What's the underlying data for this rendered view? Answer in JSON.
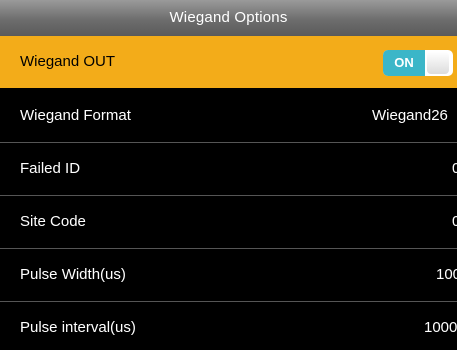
{
  "header": {
    "title": "Wiegand Options"
  },
  "rows": [
    {
      "label": "Wiegand OUT",
      "toggle_label": "ON",
      "toggle_state": "on"
    },
    {
      "label": "Wiegand Format",
      "value": "Wiegand26"
    },
    {
      "label": "Failed ID",
      "value": "0"
    },
    {
      "label": "Site Code",
      "value": "0"
    },
    {
      "label": "Pulse Width(us)",
      "value": "100"
    },
    {
      "label": "Pulse interval(us)",
      "value": "1000"
    }
  ],
  "colors": {
    "selected_row": "#f3ac19",
    "toggle_on": "#3bb6c8",
    "background": "#000000"
  }
}
